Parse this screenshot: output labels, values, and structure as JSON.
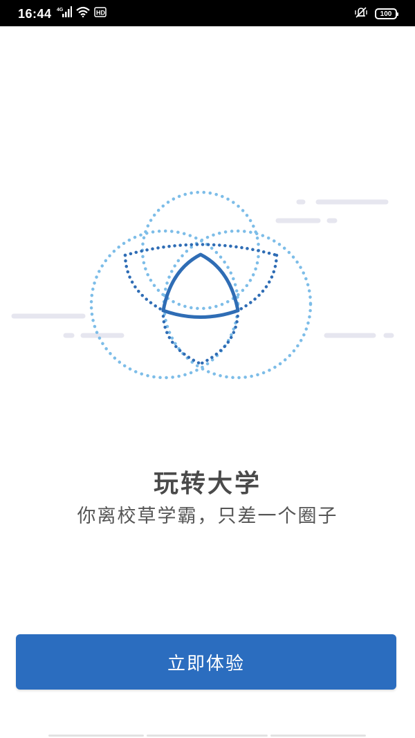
{
  "status_bar": {
    "time": "16:44",
    "battery_level": "100",
    "signal_label": "4G",
    "hd_label": "HD",
    "icons": [
      "signal-icon",
      "wifi-icon",
      "hd-icon",
      "vibrate-icon",
      "battery-icon"
    ]
  },
  "illustration": {
    "icon": "venn-circles-icon",
    "colors": {
      "light_dots": "#7dbde8",
      "dark_dots": "#2f6db5",
      "solid_shape": "#2f6db5",
      "cloud_lines": "#e6e6ef"
    }
  },
  "intro": {
    "title": "玩转大学",
    "subtitle": "你离校草学霸，只差一个圈子"
  },
  "cta": {
    "label": "立即体验",
    "color": "#2b6dbf"
  }
}
